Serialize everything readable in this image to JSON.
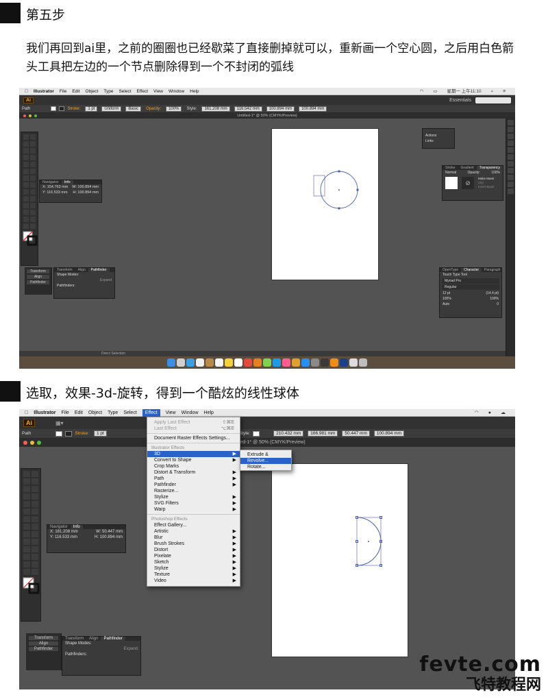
{
  "step5": {
    "title": "第五步",
    "text": "我们再回到ai里，之前的圈圈也已经歇菜了直接删掉就可以，重新画一个空心圆，之后用白色箭头工具把左边的一个节点删除得到一个不封闭的弧线"
  },
  "step6": {
    "title": "选取，效果-3d-旋转，得到一个酷炫的线性球体"
  },
  "shot1": {
    "menubar": {
      "app": "Illustrator",
      "items": [
        "File",
        "Edit",
        "Object",
        "Type",
        "Select",
        "Effect",
        "View",
        "Window",
        "Help"
      ],
      "clock": "星期一 上午11:10"
    },
    "workspace": "Essentials",
    "control": {
      "mode": "Path",
      "stroke_label": "Stroke:",
      "stroke_value": "1 pt",
      "profile": "Uniform",
      "brush": "Basic",
      "opacity_label": "Opacity:",
      "opacity_value": "100%",
      "style_label": "Style:",
      "x": "161.208 mm",
      "y": "116.542 mm",
      "w": "100.894 mm",
      "h": "100.894 mm"
    },
    "doc_title": "Untitled-1* @ 50% (CMYK/Preview)",
    "status": "Direct Selection",
    "info": {
      "tabs": [
        "Navigator",
        "Info"
      ],
      "x": "X: 154.763 mm",
      "y": "Y: 116.533 mm",
      "w": "W: 100.894 mm",
      "h": "H: 100.894 mm"
    },
    "pathfinder": {
      "tabs": [
        "Transform",
        "Align",
        "Pathfinder"
      ],
      "shape_modes": "Shape Modes:",
      "pathfinders": "Pathfinders:",
      "expand": "Expand",
      "dock_items": [
        "Transform",
        "Align",
        "Pathfinder"
      ]
    },
    "libs": [
      "Actions",
      "Links"
    ],
    "transparency": {
      "tabs": [
        "Stroke",
        "Gradient",
        "Transparency"
      ],
      "mode": "Normal",
      "opacity_label": "Opacity:",
      "opacity": "100%",
      "make_mask": "Make Mask",
      "clip": "Clip",
      "invert": "Invert Mask"
    },
    "character": {
      "tabs": [
        "OpenType",
        "Character",
        "Paragraph"
      ],
      "search": "Touch Type Tool",
      "font": "Myriad Pro",
      "style": "Regular",
      "size": "12 pt",
      "leading": "(14.4 pt)",
      "tracking": "Auto",
      "kerning": "0",
      "scale_h": "100%",
      "scale_v": "100%"
    }
  },
  "shot2": {
    "menubar": {
      "app": "Illustrator",
      "items": [
        "File",
        "Edit",
        "Object",
        "Type",
        "Select",
        "Effect",
        "View",
        "Window",
        "Help"
      ],
      "open": "Effect"
    },
    "control": {
      "mode": "Path",
      "stroke_label": "Stroke:",
      "stroke_value": "1 pt",
      "style_label": "Style:",
      "x": "210.432 mm",
      "y": "166.981 mm",
      "w": "50.447 mm",
      "h": "100.894 mm"
    },
    "doc_title": "Untitled-1* @ 50% (CMYK/Preview)",
    "effect_menu": {
      "apply_last": "Apply Last Effect",
      "apply_last_sc": "⇧⌘E",
      "last": "Last Effect",
      "last_sc": "⌥⌘E",
      "raster_settings": "Document Raster Effects Settings...",
      "illustrator_header": "Illustrator Effects",
      "illustrator_items": [
        "3D",
        "Convert to Shape",
        "Crop Marks",
        "Distort & Transform",
        "Path",
        "Pathfinder",
        "Rasterize...",
        "Stylize",
        "SVG Filters",
        "Warp"
      ],
      "photoshop_header": "Photoshop Effects",
      "photoshop_items": [
        "Effect Gallery...",
        "Artistic",
        "Blur",
        "Brush Strokes",
        "Distort",
        "Pixelate",
        "Sketch",
        "Stylize",
        "Texture",
        "Video"
      ],
      "submenu_3d": [
        "Extrude & Bevel...",
        "Revolve...",
        "Rotate..."
      ]
    },
    "info": {
      "tabs": [
        "Navigator",
        "Info"
      ],
      "x": "X: 181.208 mm",
      "y": "Y: 116.533 mm",
      "w": "W: 50.447 mm",
      "h": "H: 100.894 mm"
    },
    "pathfinder": {
      "tabs": [
        "Transform",
        "Align",
        "Pathfinder"
      ],
      "shape_modes": "Shape Modes:",
      "pathfinders": "Pathfinders:",
      "expand": "Expand",
      "dock_items": [
        "Transform",
        "Align",
        "Pathfinder"
      ]
    }
  },
  "watermark": {
    "line1": "fevte.com",
    "line2": "飞特教程网"
  }
}
